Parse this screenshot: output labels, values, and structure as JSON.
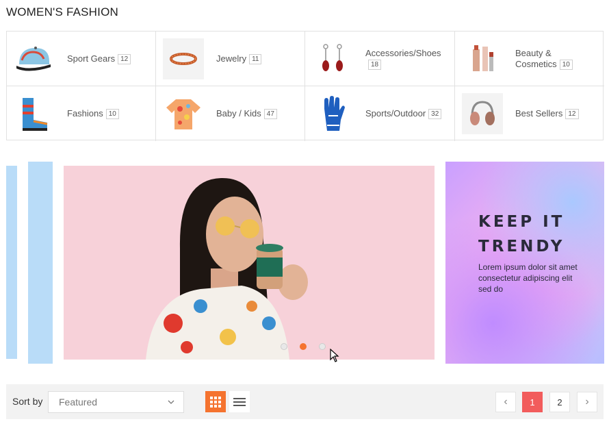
{
  "page": {
    "title": "WOMEN'S FASHION"
  },
  "categories": [
    {
      "label": "Sport Gears",
      "count": "12",
      "icon": "cap-icon"
    },
    {
      "label": "Jewelry",
      "count": "11",
      "icon": "bracelet-icon"
    },
    {
      "label": "Accessories/Shoes",
      "count": "18",
      "icon": "earrings-icon"
    },
    {
      "label": "Beauty & Cosmetics",
      "count": "10",
      "icon": "lipstick-icon"
    },
    {
      "label": "Fashions",
      "count": "10",
      "icon": "boots-icon"
    },
    {
      "label": "Baby / Kids",
      "count": "47",
      "icon": "shirt-icon"
    },
    {
      "label": "Sports/Outdoor",
      "count": "32",
      "icon": "glove-icon"
    },
    {
      "label": "Best Sellers",
      "count": "12",
      "icon": "headphones-icon"
    }
  ],
  "banner": {
    "side_title_line1": "KEEP IT",
    "side_title_line2": "TRENDY",
    "side_text": "Lorem ipsum dolor sit amet consectetur adipiscing elit sed do",
    "active_dot": 2,
    "dot_count": 3
  },
  "toolbar": {
    "sort_label": "Sort by",
    "sort_value": "Featured",
    "view_modes": [
      "grid",
      "list"
    ],
    "active_view": "grid",
    "pages": [
      "1",
      "2"
    ],
    "current_page": "1",
    "prev_label": "‹",
    "next_label": "›"
  },
  "colors": {
    "accent": "#f5732f",
    "page_active": "#f25c5c",
    "banner_pink": "#f7d1d9",
    "strip_blue": "#b9dcf8"
  }
}
